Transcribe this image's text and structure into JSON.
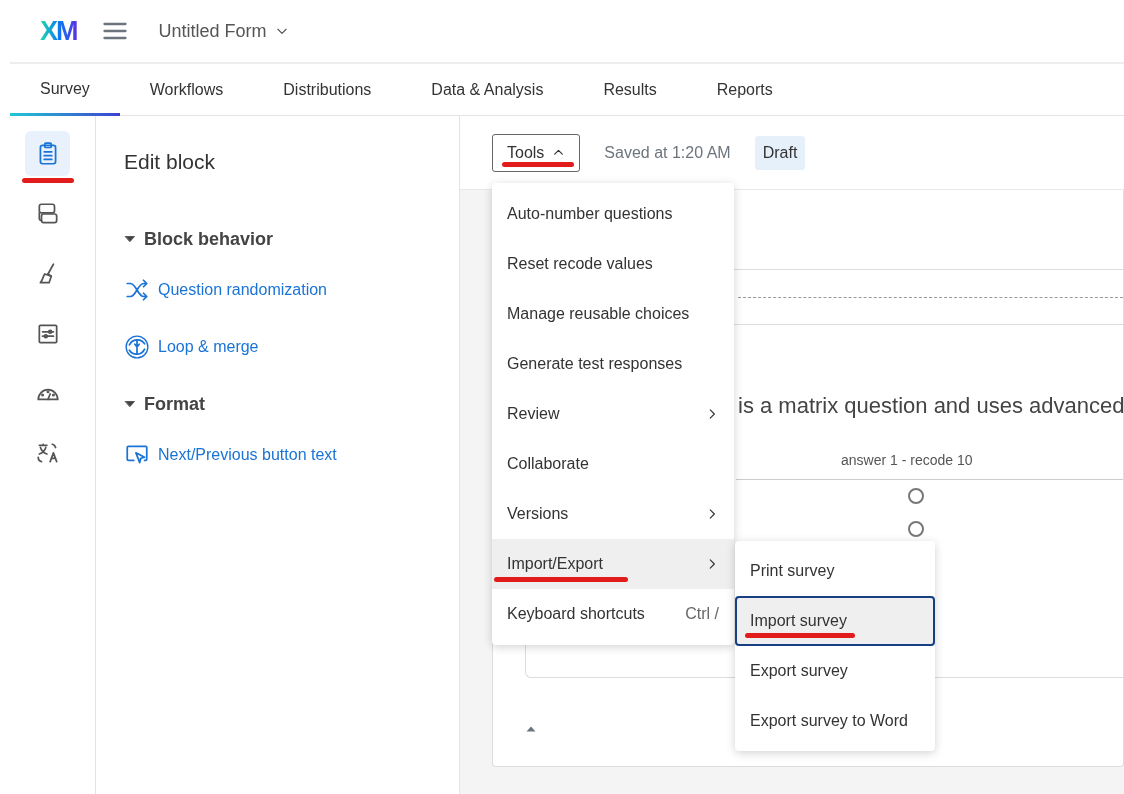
{
  "header": {
    "logo": "XM",
    "project_title": "Untitled Form"
  },
  "tabs": [
    {
      "label": "Survey",
      "selected": true
    },
    {
      "label": "Workflows",
      "selected": false
    },
    {
      "label": "Distributions",
      "selected": false
    },
    {
      "label": "Data & Analysis",
      "selected": false
    },
    {
      "label": "Results",
      "selected": false
    },
    {
      "label": "Reports",
      "selected": false
    }
  ],
  "rail": [
    {
      "kind": "clipboard",
      "selected": true,
      "annotated": true
    },
    {
      "kind": "blocks",
      "selected": false,
      "annotated": false
    },
    {
      "kind": "brush",
      "selected": false,
      "annotated": false
    },
    {
      "kind": "sliders",
      "selected": false,
      "annotated": false
    },
    {
      "kind": "gauge",
      "selected": false,
      "annotated": false
    },
    {
      "kind": "translate",
      "selected": false,
      "annotated": false
    }
  ],
  "edit_panel": {
    "title": "Edit block",
    "sections": [
      {
        "title": "Block behavior",
        "expanded": true,
        "links": [
          {
            "kind": "shuffle",
            "label": "Question randomization"
          },
          {
            "kind": "loop",
            "label": "Loop & merge"
          }
        ]
      },
      {
        "title": "Format",
        "expanded": true,
        "links": [
          {
            "kind": "pointer",
            "label": "Next/Previous button text"
          }
        ]
      }
    ]
  },
  "toolbar": {
    "tools_button": {
      "label": "Tools",
      "expanded": true,
      "annotated": true
    },
    "saved_text": "Saved at 1:20 AM",
    "status": "Draft"
  },
  "survey": {
    "question_text": "is a matrix question and uses advanced",
    "column_header": "answer 1 - recode 10",
    "radios": [
      {
        "selected": false
      },
      {
        "selected": false
      }
    ]
  },
  "tools_menu": [
    {
      "label": "Auto-number questions",
      "submenu": false,
      "selected": false,
      "annotated": false
    },
    {
      "label": "Reset recode values",
      "submenu": false,
      "selected": false,
      "annotated": false
    },
    {
      "label": "Manage reusable choices",
      "submenu": false,
      "selected": false,
      "annotated": false
    },
    {
      "label": "Generate test responses",
      "submenu": false,
      "selected": false,
      "annotated": false
    },
    {
      "label": "Review",
      "submenu": true,
      "selected": false,
      "annotated": false
    },
    {
      "label": "Collaborate",
      "submenu": false,
      "selected": false,
      "annotated": false
    },
    {
      "label": "Versions",
      "submenu": true,
      "selected": false,
      "annotated": false
    },
    {
      "label": "Import/Export",
      "submenu": true,
      "selected": true,
      "annotated": true
    },
    {
      "label": "Keyboard shortcuts",
      "shortcut": "Ctrl /",
      "submenu": false,
      "selected": false,
      "annotated": false
    }
  ],
  "import_export_menu": [
    {
      "label": "Print survey",
      "focused": false,
      "annotated": false
    },
    {
      "label": "Import survey",
      "focused": true,
      "annotated": true
    },
    {
      "label": "Export survey",
      "focused": false,
      "annotated": false
    },
    {
      "label": "Export survey to Word",
      "focused": false,
      "annotated": false
    }
  ]
}
